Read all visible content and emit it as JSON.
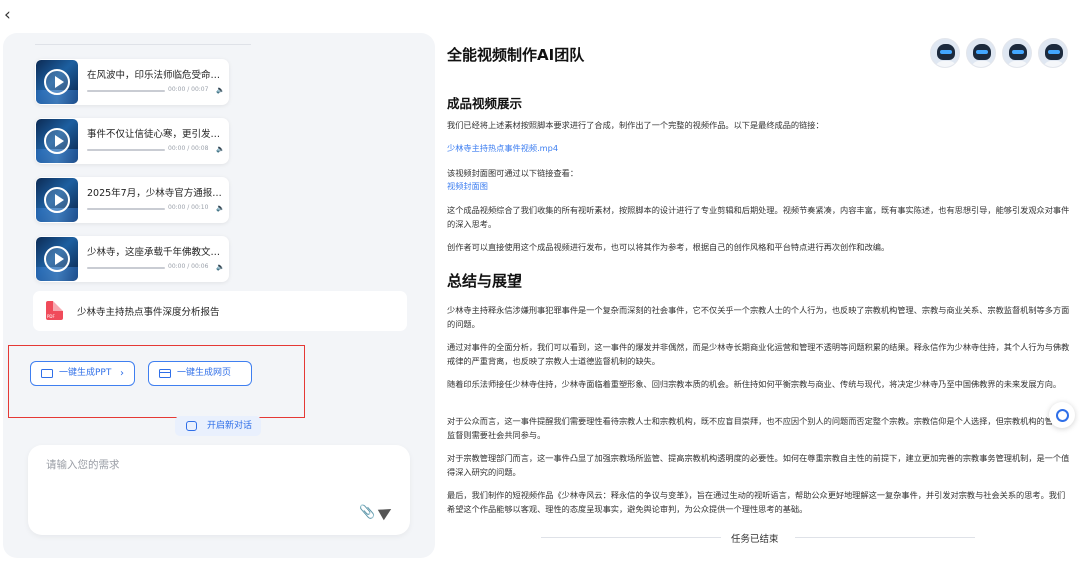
{
  "nav": {
    "back_icon": "chevron-left-icon"
  },
  "media_items": [
    {
      "title": "在风波中，印乐法师临危受命。...",
      "time": "00:00 / 00:07",
      "progress": 0
    },
    {
      "title": "事件不仅让信徒心寒，更引发公...",
      "time": "00:00 / 00:08",
      "progress": 0
    },
    {
      "title": "2025年7月，少林寺官方通报释...",
      "time": "00:00 / 00:10",
      "progress": 0
    },
    {
      "title": "少林寺，这座承载千年佛教文化...",
      "time": "00:00 / 00:06",
      "progress": 0
    }
  ],
  "report": {
    "label": "少林寺主持热点事件深度分析报告",
    "icon_text": "PDF"
  },
  "actions": {
    "ppt_label": "一键生成PPT",
    "web_label": "一键生成网页",
    "new_chat_label": "开启新对话"
  },
  "input": {
    "placeholder": "请输入您的需求"
  },
  "right": {
    "team_title": "全能视频制作AI团队",
    "section1_title": "成品视频展示",
    "s1_p1": "我们已经将上述素材按照脚本要求进行了合成，制作出了一个完整的视频作品。以下是最终成品的链接：",
    "video_link": "少林寺主持热点事件视频.mp4",
    "cover_intro": "该视频封面图可通过以下链接查看：",
    "cover_link": "视频封面图",
    "s1_p2": "这个成品视频综合了我们收集的所有视听素材，按照脚本的设计进行了专业剪辑和后期处理。视频节奏紧凑，内容丰富，既有事实陈述，也有思想引导，能够引发观众对事件的深入思考。",
    "s1_p3": "创作者可以直接使用这个成品视频进行发布，也可以将其作为参考，根据自己的创作风格和平台特点进行再次创作和改编。",
    "section2_title": "总结与展望",
    "s2_p1": "少林寺主持释永信涉嫌刑事犯罪事件是一个复杂而深刻的社会事件，它不仅关乎一个宗教人士的个人行为，也反映了宗教机构管理、宗教与商业关系、宗教监督机制等多方面的问题。",
    "s2_p2": "通过对事件的全面分析，我们可以看到，这一事件的爆发并非偶然，而是少林寺长期商业化运营和管理不透明等问题积累的结果。释永信作为少林寺住持，其个人行为与佛教戒律的严重背离，也反映了宗教人士道德监督机制的缺失。",
    "s2_p3": "随着印乐法师接任少林寺住持，少林寺面临着重塑形象、回归宗教本质的机会。新住持如何平衡宗教与商业、传统与现代，将决定少林寺乃至中国佛教界的未来发展方向。",
    "s2_p4": "对于公众而言，这一事件提醒我们需要理性看待宗教人士和宗教机构，既不应盲目崇拜，也不应因个别人的问题而否定整个宗教。宗教信仰是个人选择，但宗教机构的管理和监督则需要社会共同参与。",
    "s2_p5": "对于宗教管理部门而言，这一事件凸显了加强宗教场所监管、提高宗教机构透明度的必要性。如何在尊重宗教自主性的前提下，建立更加完善的宗教事务管理机制，是一个值得深入研究的问题。",
    "s2_p6": "最后，我们制作的短视频作品《少林寺风云：释永信的争议与变革》，旨在通过生动的视听语言，帮助公众更好地理解这一复杂事件，并引发对宗教与社会关系的思考。我们希望这个作品能够以客观、理性的态度呈现事实，避免舆论审判，为公众提供一个理性思考的基础。",
    "done_label": "任务已结束"
  }
}
